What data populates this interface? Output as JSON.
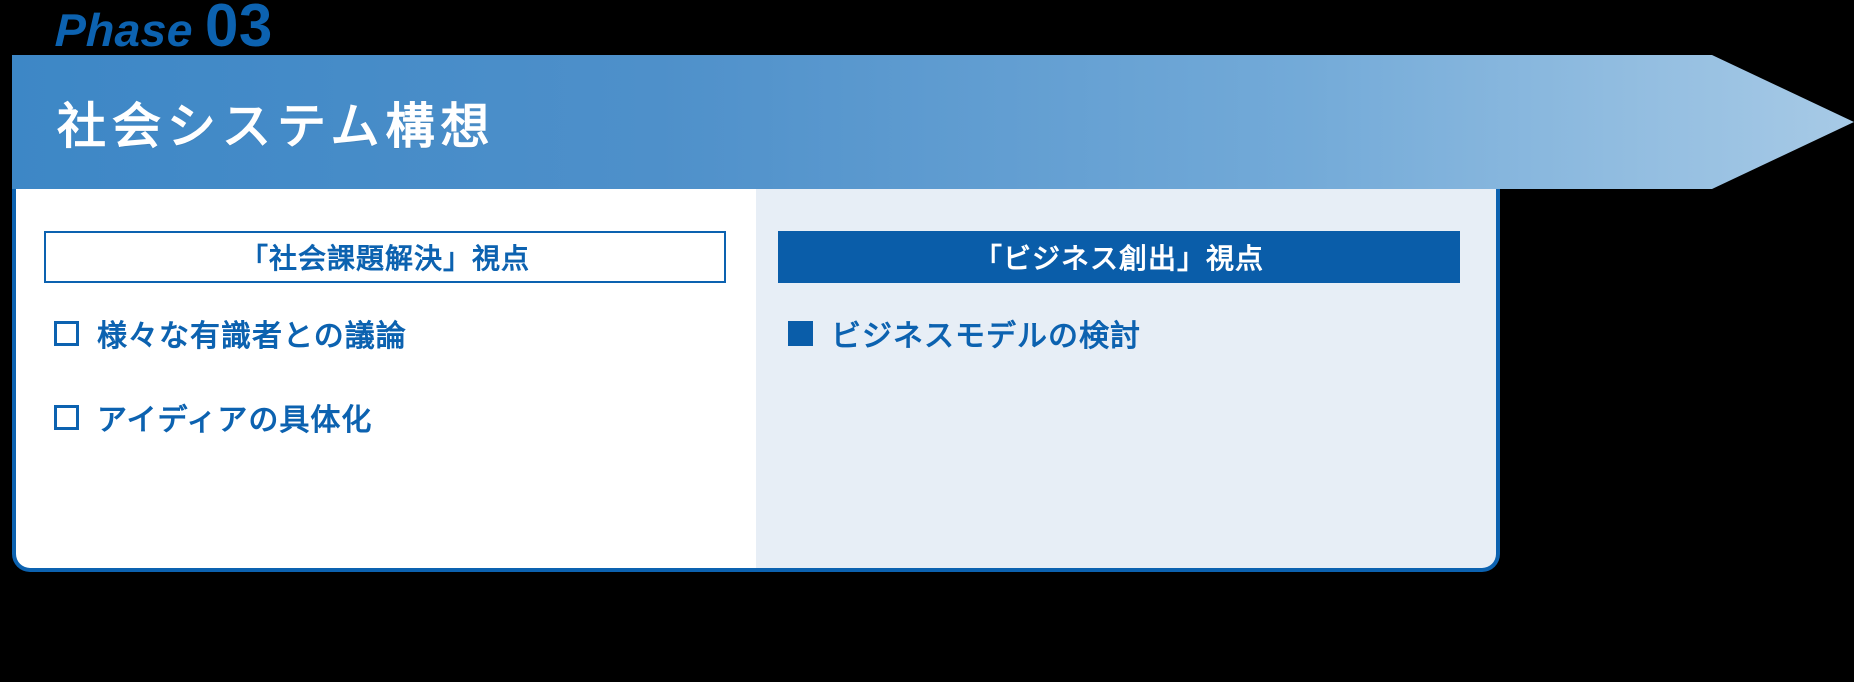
{
  "phase": {
    "word": "Phase",
    "number": "03"
  },
  "banner": {
    "title": "社会システム構想"
  },
  "columns": [
    {
      "id": "social-issue",
      "header": "「社会課題解決」視点",
      "header_style": "outline",
      "items": [
        {
          "mark": "open-square-bullet",
          "label": "様々な有識者との議論"
        },
        {
          "mark": "open-square-bullet",
          "label": "アイディアの具体化"
        }
      ]
    },
    {
      "id": "business-creation",
      "header": "「ビジネス創出」視点",
      "header_style": "filled",
      "items": [
        {
          "mark": "filled-square-bullet",
          "label": "ビジネスモデルの検討"
        }
      ]
    }
  ],
  "colors": {
    "brand_blue": "#0c62b0",
    "header_fill_blue": "#0a5da9",
    "banner_gradient_start": "#3d87c6",
    "banner_gradient_end": "#a7cae6",
    "right_panel_bg": "#e7eef6",
    "left_panel_bg": "#ffffff",
    "page_bg": "#000000"
  }
}
